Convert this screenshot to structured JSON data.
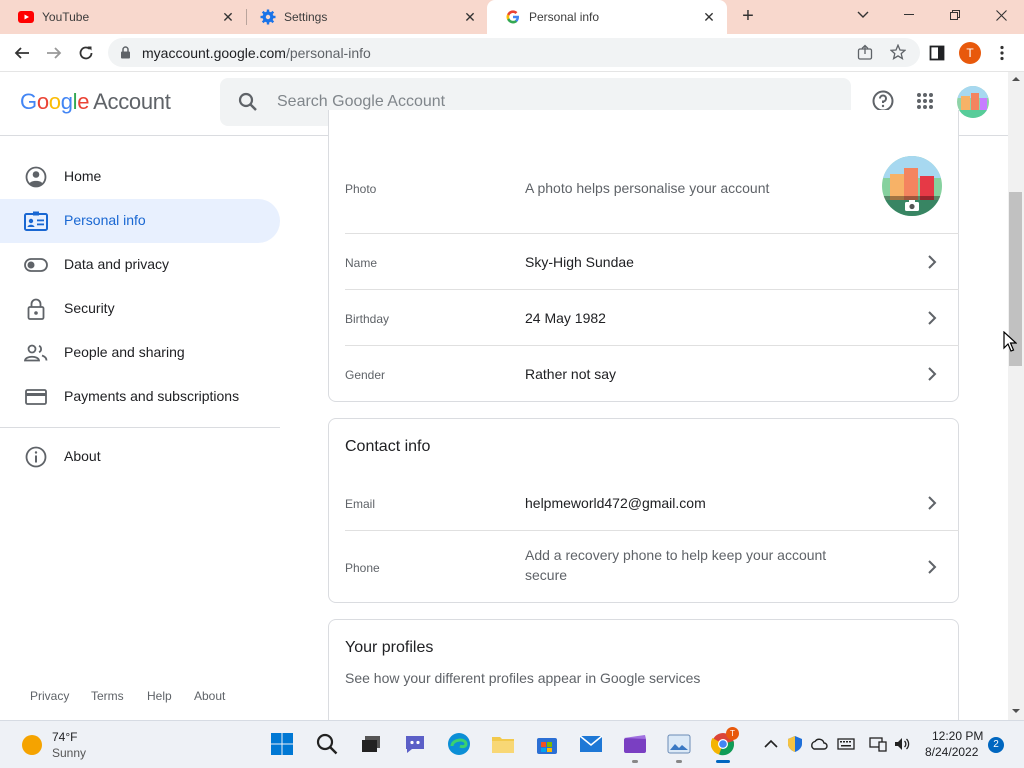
{
  "browser": {
    "tabs": [
      {
        "title": "YouTube",
        "icon": "youtube-icon"
      },
      {
        "title": "Settings",
        "icon": "gear-icon"
      },
      {
        "title": "Personal info",
        "icon": "google-g-icon",
        "active": true
      }
    ],
    "new_tab": "+",
    "url_host": "myaccount.google.com",
    "url_path": "/personal-info",
    "profile_initial": "T"
  },
  "header": {
    "logo_google": [
      "G",
      "o",
      "o",
      "g",
      "l",
      "e"
    ],
    "logo_colors": [
      "#4285F4",
      "#EA4335",
      "#FBBC05",
      "#4285F4",
      "#34A853",
      "#EA4335"
    ],
    "logo_account": "Account",
    "search_placeholder": "Search Google Account"
  },
  "sidebar": {
    "items": [
      {
        "label": "Home",
        "icon": "account-circle-icon"
      },
      {
        "label": "Personal info",
        "icon": "id-card-icon",
        "active": true
      },
      {
        "label": "Data and privacy",
        "icon": "toggle-icon"
      },
      {
        "label": "Security",
        "icon": "lock-icon"
      },
      {
        "label": "People and sharing",
        "icon": "people-icon"
      },
      {
        "label": "Payments and subscriptions",
        "icon": "credit-card-icon"
      }
    ],
    "about": "About",
    "footer": [
      "Privacy",
      "Terms",
      "Help",
      "About"
    ]
  },
  "basic_info": {
    "photo_label": "Photo",
    "photo_desc": "A photo helps personalise your account",
    "name_label": "Name",
    "name_value": "Sky-High Sundae",
    "birthday_label": "Birthday",
    "birthday_value": "24 May 1982",
    "gender_label": "Gender",
    "gender_value": "Rather not say"
  },
  "contact_info": {
    "title": "Contact info",
    "email_label": "Email",
    "email_value": "helpmeworld472@gmail.com",
    "phone_label": "Phone",
    "phone_value_line1": "Add a recovery phone to help keep your account",
    "phone_value_line2": "secure"
  },
  "profiles": {
    "title": "Your profiles",
    "desc": "See how your different profiles appear in Google services"
  },
  "taskbar": {
    "weather_temp": "74°F",
    "weather_desc": "Sunny",
    "time": "12:20 PM",
    "date": "8/24/2022",
    "notification_count": "2",
    "chrome_badge": "T"
  },
  "colors": {
    "accent": "#1a73e8",
    "active_nav_bg": "#e8f0fe",
    "tabstrip": "#f8d8cd"
  }
}
